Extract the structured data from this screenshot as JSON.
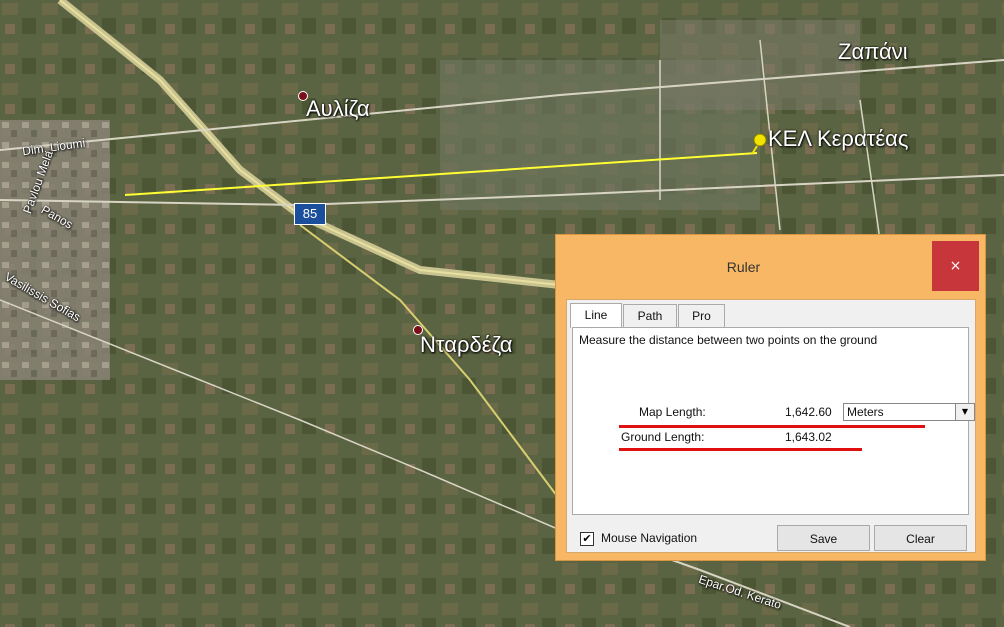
{
  "map": {
    "places": {
      "aulida": "Αυλίζα",
      "ntardeza": "Νταρδέζα",
      "zapani": "Ζαπάνι",
      "kel": "ΚΕΛ Κερατέας"
    },
    "roads": {
      "dim_lioumi": "Dim. Lioumi",
      "pavlou_mela": "Pavlou Mela",
      "panos": "Panos",
      "vasilissis_sofias": "Vasilissis Sofias",
      "epar_od": "Epar.Od. Kerato"
    },
    "route_shield": "85",
    "colors": {
      "measure_line": "#ffff33",
      "road": "#e8e2b0"
    }
  },
  "ruler": {
    "title": "Ruler",
    "close": "×",
    "tabs": [
      "Line",
      "Path",
      "Pro"
    ],
    "active_tab": "Line",
    "description": "Measure the distance between two points on the ground",
    "map_length_label": "Map Length:",
    "map_length_value": "1,642.60",
    "ground_length_label": "Ground Length:",
    "ground_length_value": "1,643.02",
    "unit": "Meters",
    "mouse_nav_label": "Mouse Navigation",
    "mouse_nav_checked": true,
    "save_label": "Save",
    "clear_label": "Clear",
    "colors": {
      "frame": "#f7b765",
      "close": "#c7363b",
      "highlight": "#e01010"
    }
  }
}
